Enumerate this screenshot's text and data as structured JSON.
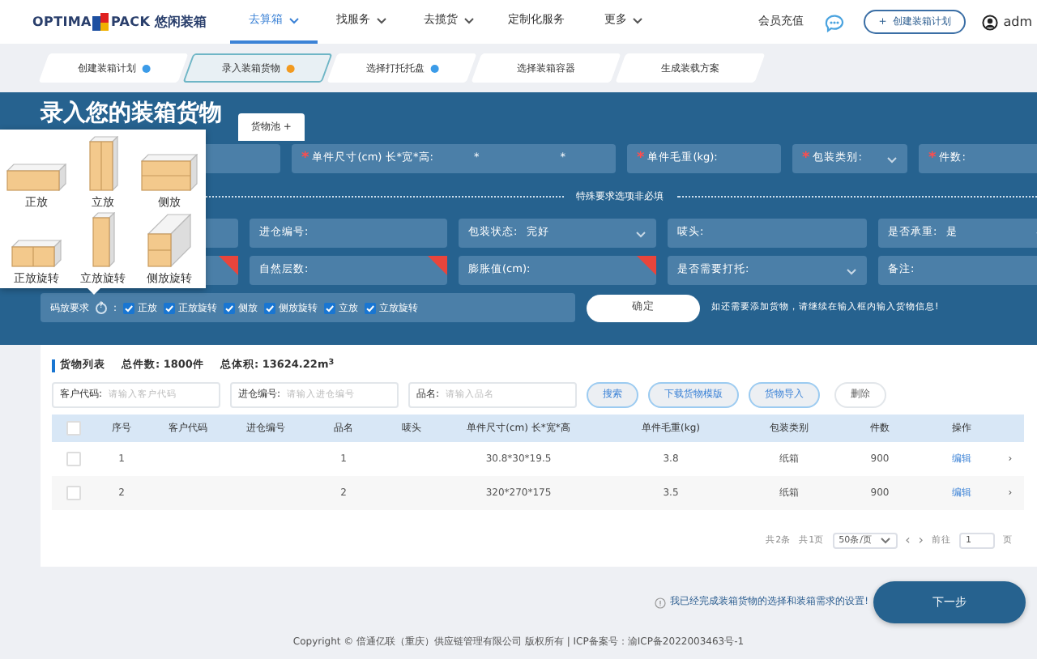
{
  "navbar": {
    "logo": {
      "left": "OPTIMA",
      "right": "PACK",
      "cn": "悠闲装箱"
    },
    "items": [
      {
        "label": "去算箱",
        "dropdown": true,
        "selected": true
      },
      {
        "label": "找服务",
        "dropdown": true,
        "selected": false
      },
      {
        "label": "去揽货",
        "dropdown": true,
        "selected": false
      },
      {
        "label": "定制化服务",
        "dropdown": false,
        "selected": false
      },
      {
        "label": "更多",
        "dropdown": true,
        "selected": false
      }
    ],
    "recharge": "会员充值",
    "create_button": {
      "icon": "+",
      "label": "创建装箱计划"
    },
    "user": "adm"
  },
  "steps": [
    {
      "label": "创建装箱计划",
      "color": "#3b9be8",
      "selected": false
    },
    {
      "label": "录入装箱货物",
      "color": "#f29a1f",
      "selected": true
    },
    {
      "label": "选择打托托盘",
      "color": "#3b9be8",
      "selected": false
    },
    {
      "label": "选择装箱容器",
      "selected": false
    },
    {
      "label": "生成装载方案",
      "selected": false
    }
  ],
  "entry": {
    "title": "录入您的装箱货物",
    "pool_tab": "货物池 +",
    "required_rows": [
      [
        {
          "kind": "input"
        },
        {
          "kind": "input",
          "required_mark": "*",
          "label": "单件尺寸(cm) 长*宽*高:",
          "value_parts": [
            "*",
            "*"
          ]
        },
        {
          "kind": "input",
          "required_mark": "*",
          "label": "单件毛重(kg):"
        },
        {
          "kind": "select",
          "required_mark": "*",
          "label": "包装类别:"
        },
        {
          "kind": "input",
          "required_mark": "*",
          "label": "件数:"
        }
      ]
    ],
    "optional_caption": "特殊要求选项非必填",
    "optional_rows": [
      [
        {
          "kind": "input"
        },
        {
          "kind": "input",
          "label": "进仓编号:"
        },
        {
          "kind": "select",
          "label": "包装状态:",
          "value": "完好"
        },
        {
          "kind": "input",
          "label": "唛头:"
        },
        {
          "kind": "select",
          "label": "是否承重:",
          "value": "是"
        }
      ],
      [
        {
          "kind": "input",
          "ribbon": true
        },
        {
          "kind": "input",
          "label": "自然层数:",
          "ribbon": true
        },
        {
          "kind": "input",
          "label": "膨胀值(cm):",
          "ribbon": true
        },
        {
          "kind": "select",
          "label": "是否需要打托:"
        },
        {
          "kind": "input",
          "label": "备注:"
        }
      ]
    ],
    "placement": {
      "label": "码放要求",
      "info_icon": "?",
      "colon": ":",
      "options": [
        {
          "label": "正放",
          "checked": true
        },
        {
          "label": "正放旋转",
          "checked": true
        },
        {
          "label": "侧放",
          "checked": true
        },
        {
          "label": "侧放旋转",
          "checked": true
        },
        {
          "label": "立放",
          "checked": true
        },
        {
          "label": "立放旋转",
          "checked": true
        }
      ]
    },
    "confirm_button": "确定",
    "hint": "如还需要添加货物，请继续在输入框内输入货物信息!",
    "orientation_popup": [
      {
        "label": "正放",
        "kind": "flat"
      },
      {
        "label": "立放",
        "kind": "upright"
      },
      {
        "label": "侧放",
        "kind": "side"
      },
      {
        "label": "正放旋转",
        "kind": "flatrot"
      },
      {
        "label": "立放旋转",
        "kind": "uprightrot"
      },
      {
        "label": "侧放旋转",
        "kind": "siderot"
      }
    ]
  },
  "cargo_list": {
    "title": "货物列表",
    "total_count": "总件数: 1800件",
    "total_volume": "总体积: 13624.22m$^{3}$",
    "filters": [
      {
        "label": "客户代码:",
        "placeholder": "请输入客户代码"
      },
      {
        "label": "进仓编号:",
        "placeholder": "请输入进仓编号"
      },
      {
        "label": "品名:",
        "placeholder": "请输入品名"
      }
    ],
    "buttons": [
      {
        "label": "搜索",
        "kind": "primary"
      },
      {
        "label": "下载货物模版",
        "kind": "primary"
      },
      {
        "label": "货物导入",
        "kind": "primary"
      },
      {
        "label": "删除",
        "kind": "plain"
      }
    ],
    "table": {
      "all_checked": false,
      "columns": [
        "序号",
        "客户代码",
        "进仓编号",
        "品名",
        "唛头",
        "单件尺寸(cm) 长*宽*高",
        "单件毛重(kg)",
        "包装类别",
        "件数",
        "操作"
      ],
      "rows": [
        {
          "selected": false,
          "cells": [
            "1",
            "",
            "",
            "1",
            "",
            "30.8*30*19.5",
            "3.8",
            "纸箱",
            "900",
            "编辑"
          ],
          "expand": "›"
        },
        {
          "selected": false,
          "cells": [
            "2",
            "",
            "",
            "2",
            "",
            "320*270*175",
            "3.5",
            "纸箱",
            "900",
            "编辑"
          ],
          "expand": "›"
        }
      ]
    },
    "pagination": {
      "total": "共2条",
      "pages": "共1页",
      "page_size": "50条/页",
      "prev": "‹",
      "next": "›",
      "goto": "前往",
      "page": "1",
      "unit": "页"
    }
  },
  "confirm_note": "我已经完成装箱货物的选择和装箱需求的设置!",
  "next_button": "下一步",
  "footer": {
    "text": "Copyright © 倍通亿联（重庆）供应链管理有限公司 版权所有 | ICP备案号：",
    "link": "渝ICP备2022003463号-1"
  }
}
